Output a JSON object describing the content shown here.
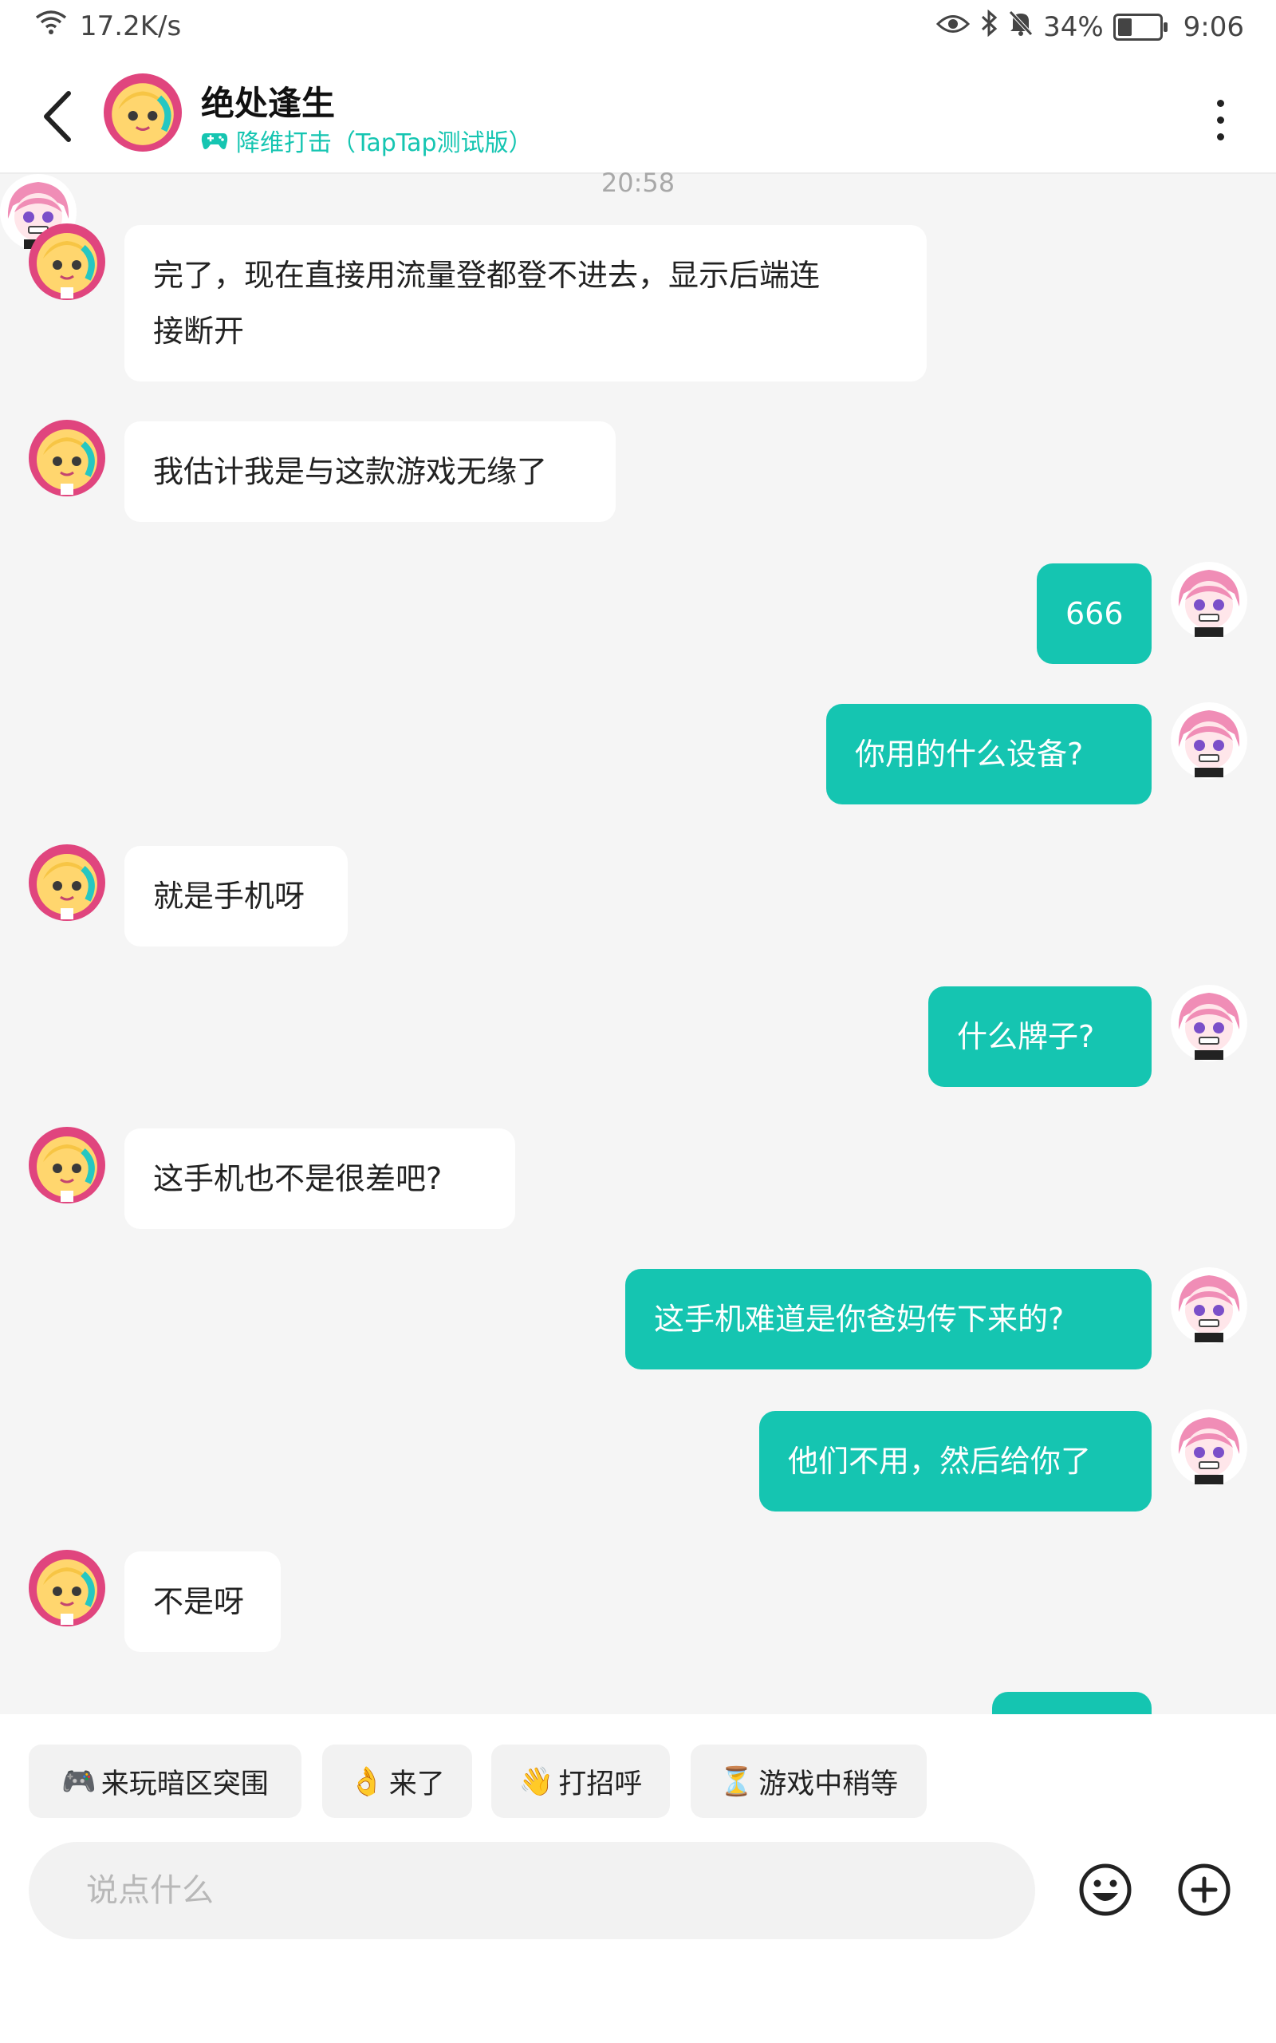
{
  "status_bar": {
    "net_speed": "17.2K/s",
    "battery_percent": "34%",
    "battery_level": 0.34,
    "time": "9:06"
  },
  "header": {
    "contact_name": "绝处逢生",
    "game_label": "降维打击（TapTap测试版）",
    "icons": {
      "back": "back-arrow-icon",
      "game": "gamepad-icon",
      "more": "more-vertical-icon"
    }
  },
  "timestamp": "20:58",
  "messages": [
    {
      "from": "them",
      "lines": [
        "完了，现在直接用流量登都登不进去，显示后端连",
        "接断开"
      ]
    },
    {
      "from": "them",
      "lines": [
        "我估计我是与这款游戏无缘了"
      ]
    },
    {
      "from": "me",
      "lines": [
        "666"
      ]
    },
    {
      "from": "me",
      "lines": [
        "你用的什么设备?"
      ]
    },
    {
      "from": "them",
      "lines": [
        "就是手机呀"
      ]
    },
    {
      "from": "me",
      "lines": [
        "什么牌子?"
      ]
    },
    {
      "from": "them",
      "lines": [
        "这手机也不是很差吧?"
      ]
    },
    {
      "from": "me",
      "lines": [
        "这手机难道是你爸妈传下来的?"
      ]
    },
    {
      "from": "me",
      "lines": [
        "他们不用，然后给你了"
      ]
    },
    {
      "from": "them",
      "lines": [
        "不是呀"
      ]
    }
  ],
  "quick_replies": [
    {
      "emoji": "🎮",
      "label": "来玩暗区突围"
    },
    {
      "emoji": "👌",
      "label": "来了"
    },
    {
      "emoji": "👋",
      "label": "打招呼"
    },
    {
      "emoji": "⏳",
      "label": "游戏中稍等"
    }
  ],
  "input": {
    "placeholder": "说点什么",
    "value": ""
  },
  "bottom_icons": {
    "emoji": "emoji-face-icon",
    "add": "plus-circle-icon"
  },
  "colors": {
    "accent": "#15c5b1",
    "background": "#f5f5f5",
    "bubble_in": "#ffffff"
  }
}
